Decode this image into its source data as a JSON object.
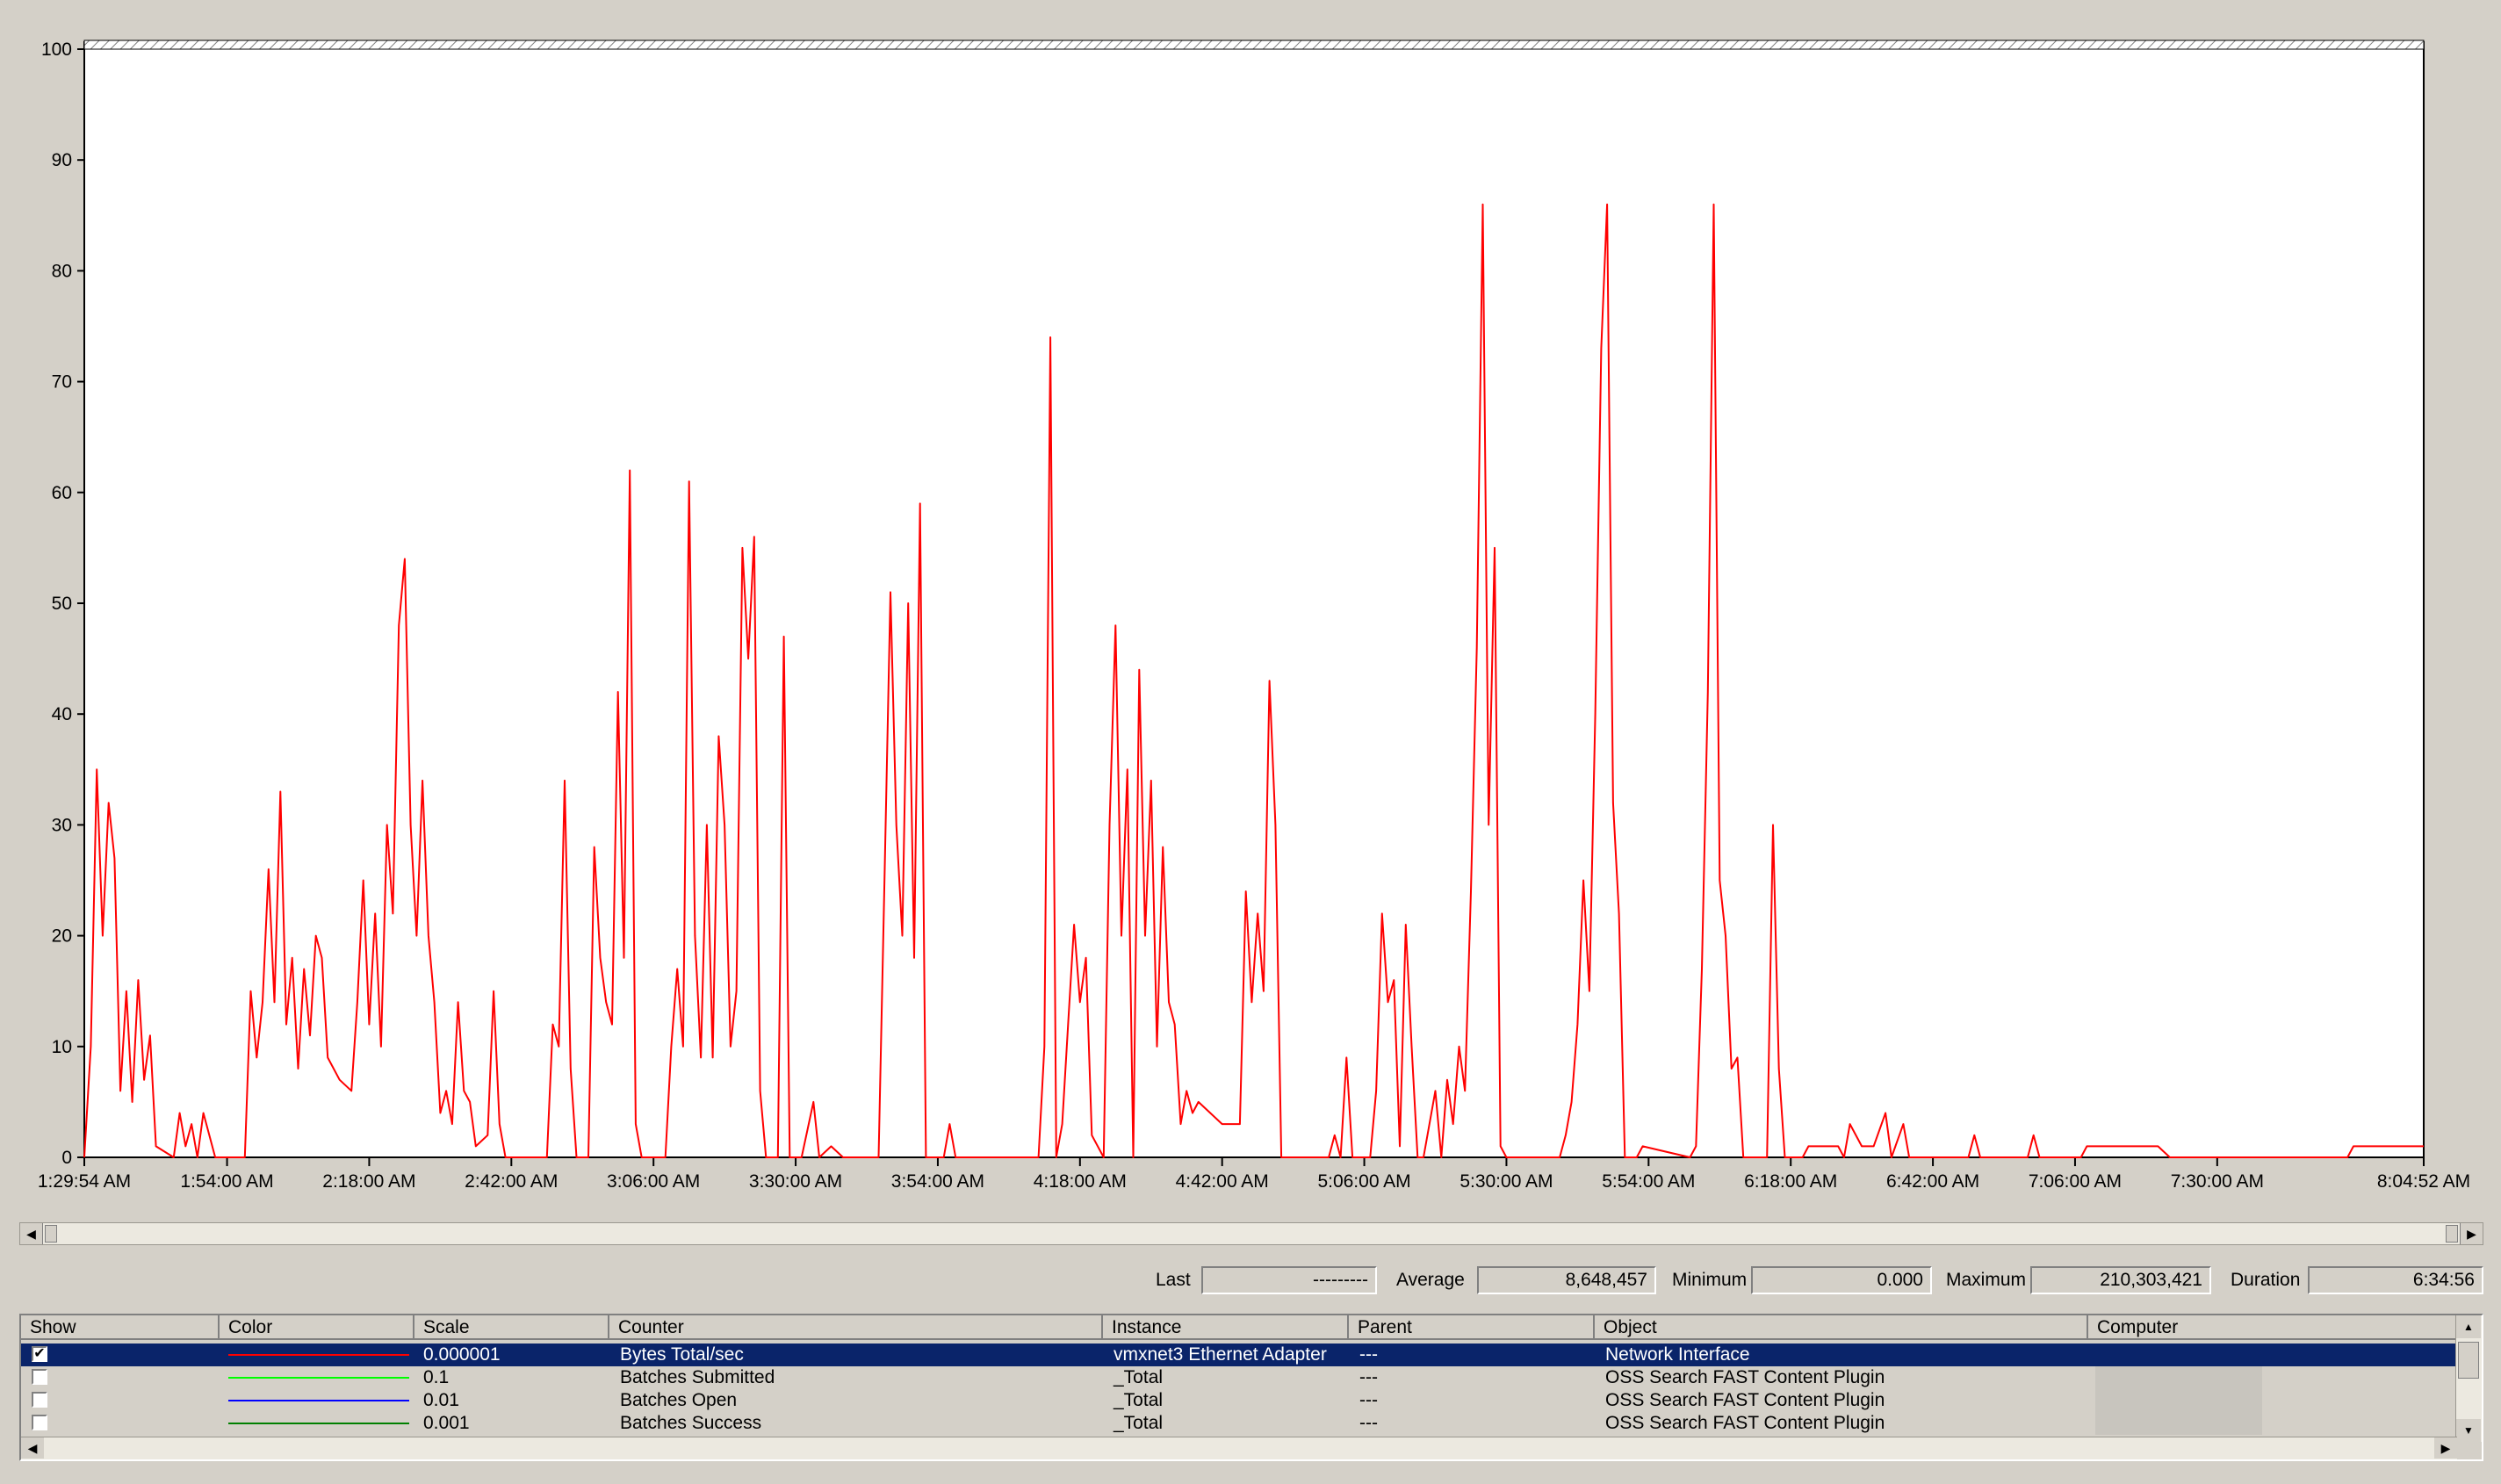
{
  "chart_data": {
    "type": "line",
    "y_ticks": [
      "100",
      "90",
      "80",
      "70",
      "60",
      "50",
      "40",
      "30",
      "20",
      "10",
      "0"
    ],
    "x_ticks": [
      "1:29:54 AM",
      "1:54:00 AM",
      "2:18:00 AM",
      "2:42:00 AM",
      "3:06:00 AM",
      "3:30:00 AM",
      "3:54:00 AM",
      "4:18:00 AM",
      "4:42:00 AM",
      "5:06:00 AM",
      "5:30:00 AM",
      "5:54:00 AM",
      "6:18:00 AM",
      "6:42:00 AM",
      "7:06:00 AM",
      "7:30:00 AM",
      "8:04:52 AM"
    ],
    "xlim": [
      "1:29:54 AM",
      "8:04:52 AM"
    ],
    "ylim": [
      0,
      100
    ],
    "grid": false,
    "series": [
      {
        "color": "#ff0000",
        "points": [
          [
            "1:29:54 AM",
            0
          ],
          [
            "1:31:00 AM",
            10
          ],
          [
            "1:32:00 AM",
            35
          ],
          [
            "1:33:00 AM",
            20
          ],
          [
            "1:34:00 AM",
            32
          ],
          [
            "1:35:00 AM",
            27
          ],
          [
            "1:36:00 AM",
            6
          ],
          [
            "1:37:00 AM",
            15
          ],
          [
            "1:38:00 AM",
            5
          ],
          [
            "1:39:00 AM",
            16
          ],
          [
            "1:40:00 AM",
            7
          ],
          [
            "1:41:00 AM",
            11
          ],
          [
            "1:42:00 AM",
            1
          ],
          [
            "1:45:00 AM",
            0
          ],
          [
            "1:46:00 AM",
            4
          ],
          [
            "1:47:00 AM",
            1
          ],
          [
            "1:48:00 AM",
            3
          ],
          [
            "1:49:00 AM",
            0
          ],
          [
            "1:50:00 AM",
            4
          ],
          [
            "1:52:00 AM",
            0
          ],
          [
            "1:57:00 AM",
            0
          ],
          [
            "1:58:00 AM",
            15
          ],
          [
            "1:59:00 AM",
            9
          ],
          [
            "2:00:00 AM",
            14
          ],
          [
            "2:01:00 AM",
            26
          ],
          [
            "2:02:00 AM",
            14
          ],
          [
            "2:03:00 AM",
            33
          ],
          [
            "2:04:00 AM",
            12
          ],
          [
            "2:05:00 AM",
            18
          ],
          [
            "2:06:00 AM",
            8
          ],
          [
            "2:07:00 AM",
            17
          ],
          [
            "2:08:00 AM",
            11
          ],
          [
            "2:09:00 AM",
            20
          ],
          [
            "2:10:00 AM",
            18
          ],
          [
            "2:11:00 AM",
            9
          ],
          [
            "2:13:00 AM",
            7
          ],
          [
            "2:15:00 AM",
            6
          ],
          [
            "2:16:00 AM",
            14
          ],
          [
            "2:17:00 AM",
            25
          ],
          [
            "2:18:00 AM",
            12
          ],
          [
            "2:19:00 AM",
            22
          ],
          [
            "2:20:00 AM",
            10
          ],
          [
            "2:21:00 AM",
            30
          ],
          [
            "2:22:00 AM",
            22
          ],
          [
            "2:23:00 AM",
            48
          ],
          [
            "2:24:00 AM",
            54
          ],
          [
            "2:25:00 AM",
            30
          ],
          [
            "2:26:00 AM",
            20
          ],
          [
            "2:27:00 AM",
            34
          ],
          [
            "2:28:00 AM",
            20
          ],
          [
            "2:29:00 AM",
            14
          ],
          [
            "2:30:00 AM",
            4
          ],
          [
            "2:31:00 AM",
            6
          ],
          [
            "2:32:00 AM",
            3
          ],
          [
            "2:33:00 AM",
            14
          ],
          [
            "2:34:00 AM",
            6
          ],
          [
            "2:35:00 AM",
            5
          ],
          [
            "2:36:00 AM",
            1
          ],
          [
            "2:38:00 AM",
            2
          ],
          [
            "2:39:00 AM",
            15
          ],
          [
            "2:40:00 AM",
            3
          ],
          [
            "2:41:00 AM",
            0
          ],
          [
            "2:48:00 AM",
            0
          ],
          [
            "2:49:00 AM",
            12
          ],
          [
            "2:50:00 AM",
            10
          ],
          [
            "2:51:00 AM",
            34
          ],
          [
            "2:52:00 AM",
            8
          ],
          [
            "2:53:00 AM",
            0
          ],
          [
            "2:55:00 AM",
            0
          ],
          [
            "2:56:00 AM",
            28
          ],
          [
            "2:57:00 AM",
            18
          ],
          [
            "2:58:00 AM",
            14
          ],
          [
            "2:59:00 AM",
            12
          ],
          [
            "3:00:00 AM",
            42
          ],
          [
            "3:01:00 AM",
            18
          ],
          [
            "3:02:00 AM",
            62
          ],
          [
            "3:03:00 AM",
            3
          ],
          [
            "3:04:00 AM",
            0
          ],
          [
            "3:08:00 AM",
            0
          ],
          [
            "3:09:00 AM",
            10
          ],
          [
            "3:10:00 AM",
            17
          ],
          [
            "3:11:00 AM",
            10
          ],
          [
            "3:12:00 AM",
            61
          ],
          [
            "3:13:00 AM",
            20
          ],
          [
            "3:14:00 AM",
            9
          ],
          [
            "3:15:00 AM",
            30
          ],
          [
            "3:16:00 AM",
            9
          ],
          [
            "3:17:00 AM",
            38
          ],
          [
            "3:18:00 AM",
            30
          ],
          [
            "3:19:00 AM",
            10
          ],
          [
            "3:20:00 AM",
            15
          ],
          [
            "3:21:00 AM",
            55
          ],
          [
            "3:22:00 AM",
            45
          ],
          [
            "3:23:00 AM",
            56
          ],
          [
            "3:24:00 AM",
            6
          ],
          [
            "3:25:00 AM",
            0
          ],
          [
            "3:27:00 AM",
            0
          ],
          [
            "3:28:00 AM",
            47
          ],
          [
            "3:29:00 AM",
            0
          ],
          [
            "3:31:00 AM",
            0
          ],
          [
            "3:33:00 AM",
            5
          ],
          [
            "3:34:00 AM",
            0
          ],
          [
            "3:36:00 AM",
            1
          ],
          [
            "3:38:00 AM",
            0
          ],
          [
            "3:44:00 AM",
            0
          ],
          [
            "3:45:00 AM",
            25
          ],
          [
            "3:46:00 AM",
            51
          ],
          [
            "3:47:00 AM",
            30
          ],
          [
            "3:48:00 AM",
            20
          ],
          [
            "3:49:00 AM",
            50
          ],
          [
            "3:50:00 AM",
            18
          ],
          [
            "3:51:00 AM",
            59
          ],
          [
            "3:52:00 AM",
            0
          ],
          [
            "3:55:00 AM",
            0
          ],
          [
            "3:56:00 AM",
            3
          ],
          [
            "3:57:00 AM",
            0
          ],
          [
            "4:11:00 AM",
            0
          ],
          [
            "4:12:00 AM",
            10
          ],
          [
            "4:13:00 AM",
            74
          ],
          [
            "4:14:00 AM",
            0
          ],
          [
            "4:15:00 AM",
            3
          ],
          [
            "4:16:00 AM",
            12
          ],
          [
            "4:17:00 AM",
            21
          ],
          [
            "4:18:00 AM",
            14
          ],
          [
            "4:19:00 AM",
            18
          ],
          [
            "4:20:00 AM",
            2
          ],
          [
            "4:22:00 AM",
            0
          ],
          [
            "4:23:00 AM",
            30
          ],
          [
            "4:24:00 AM",
            48
          ],
          [
            "4:25:00 AM",
            20
          ],
          [
            "4:26:00 AM",
            35
          ],
          [
            "4:27:00 AM",
            0
          ],
          [
            "4:28:00 AM",
            44
          ],
          [
            "4:29:00 AM",
            20
          ],
          [
            "4:30:00 AM",
            34
          ],
          [
            "4:31:00 AM",
            10
          ],
          [
            "4:32:00 AM",
            28
          ],
          [
            "4:33:00 AM",
            14
          ],
          [
            "4:34:00 AM",
            12
          ],
          [
            "4:35:00 AM",
            3
          ],
          [
            "4:36:00 AM",
            6
          ],
          [
            "4:37:00 AM",
            4
          ],
          [
            "4:38:00 AM",
            5
          ],
          [
            "4:40:00 AM",
            4
          ],
          [
            "4:42:00 AM",
            3
          ],
          [
            "4:45:00 AM",
            3
          ],
          [
            "4:46:00 AM",
            24
          ],
          [
            "4:47:00 AM",
            14
          ],
          [
            "4:48:00 AM",
            22
          ],
          [
            "4:49:00 AM",
            15
          ],
          [
            "4:50:00 AM",
            43
          ],
          [
            "4:51:00 AM",
            30
          ],
          [
            "4:52:00 AM",
            0
          ],
          [
            "5:00:00 AM",
            0
          ],
          [
            "5:01:00 AM",
            2
          ],
          [
            "5:02:00 AM",
            0
          ],
          [
            "5:03:00 AM",
            9
          ],
          [
            "5:04:00 AM",
            0
          ],
          [
            "5:07:00 AM",
            0
          ],
          [
            "5:08:00 AM",
            6
          ],
          [
            "5:09:00 AM",
            22
          ],
          [
            "5:10:00 AM",
            14
          ],
          [
            "5:11:00 AM",
            16
          ],
          [
            "5:12:00 AM",
            1
          ],
          [
            "5:13:00 AM",
            21
          ],
          [
            "5:14:00 AM",
            10
          ],
          [
            "5:15:00 AM",
            0
          ],
          [
            "5:16:00 AM",
            0
          ],
          [
            "5:18:00 AM",
            6
          ],
          [
            "5:19:00 AM",
            0
          ],
          [
            "5:20:00 AM",
            7
          ],
          [
            "5:21:00 AM",
            3
          ],
          [
            "5:22:00 AM",
            10
          ],
          [
            "5:23:00 AM",
            6
          ],
          [
            "5:24:00 AM",
            24
          ],
          [
            "5:25:00 AM",
            46
          ],
          [
            "5:26:00 AM",
            86
          ],
          [
            "5:27:00 AM",
            30
          ],
          [
            "5:28:00 AM",
            55
          ],
          [
            "5:29:00 AM",
            1
          ],
          [
            "5:30:00 AM",
            0
          ],
          [
            "5:39:00 AM",
            0
          ],
          [
            "5:40:00 AM",
            2
          ],
          [
            "5:41:00 AM",
            5
          ],
          [
            "5:42:00 AM",
            12
          ],
          [
            "5:43:00 AM",
            25
          ],
          [
            "5:44:00 AM",
            15
          ],
          [
            "5:45:00 AM",
            40
          ],
          [
            "5:46:00 AM",
            73
          ],
          [
            "5:47:00 AM",
            86
          ],
          [
            "5:48:00 AM",
            32
          ],
          [
            "5:49:00 AM",
            22
          ],
          [
            "5:50:00 AM",
            0
          ],
          [
            "5:52:00 AM",
            0
          ],
          [
            "5:53:00 AM",
            1
          ],
          [
            "6:01:00 AM",
            0
          ],
          [
            "6:02:00 AM",
            1
          ],
          [
            "6:03:00 AM",
            17
          ],
          [
            "6:04:00 AM",
            42
          ],
          [
            "6:05:00 AM",
            86
          ],
          [
            "6:06:00 AM",
            25
          ],
          [
            "6:07:00 AM",
            20
          ],
          [
            "6:08:00 AM",
            8
          ],
          [
            "6:09:00 AM",
            9
          ],
          [
            "6:10:00 AM",
            0
          ],
          [
            "6:14:00 AM",
            0
          ],
          [
            "6:15:00 AM",
            30
          ],
          [
            "6:16:00 AM",
            8
          ],
          [
            "6:17:00 AM",
            0
          ],
          [
            "6:20:00 AM",
            0
          ],
          [
            "6:21:00 AM",
            1
          ],
          [
            "6:25:00 AM",
            1
          ],
          [
            "6:26:00 AM",
            1
          ],
          [
            "6:27:00 AM",
            0
          ],
          [
            "6:28:00 AM",
            3
          ],
          [
            "6:30:00 AM",
            1
          ],
          [
            "6:32:00 AM",
            1
          ],
          [
            "6:34:00 AM",
            4
          ],
          [
            "6:35:00 AM",
            0
          ],
          [
            "6:37:00 AM",
            3
          ],
          [
            "6:38:00 AM",
            0
          ],
          [
            "6:48:00 AM",
            0
          ],
          [
            "6:49:00 AM",
            2
          ],
          [
            "6:50:00 AM",
            0
          ],
          [
            "6:58:00 AM",
            0
          ],
          [
            "6:59:00 AM",
            2
          ],
          [
            "7:00:00 AM",
            0
          ],
          [
            "7:07:00 AM",
            0
          ],
          [
            "7:08:00 AM",
            1
          ],
          [
            "7:20:00 AM",
            1
          ],
          [
            "7:22:00 AM",
            0
          ],
          [
            "7:52:00 AM",
            0
          ],
          [
            "7:53:00 AM",
            1
          ],
          [
            "8:04:52 AM",
            1
          ]
        ]
      }
    ]
  },
  "stats": {
    "last_label": "Last",
    "last_value": "---------",
    "average_label": "Average",
    "average_value": "8,648,457",
    "minimum_label": "Minimum",
    "minimum_value": "0.000",
    "maximum_label": "Maximum",
    "maximum_value": "210,303,421",
    "duration_label": "Duration",
    "duration_value": "6:34:56"
  },
  "legend": {
    "headers": [
      "Show",
      "Color",
      "Scale",
      "Counter",
      "Instance",
      "Parent",
      "Object",
      "Computer"
    ],
    "rows": [
      {
        "checked": true,
        "color": "#ff0000",
        "scale": "0.000001",
        "counter": "Bytes Total/sec",
        "instance": "vmxnet3 Ethernet Adapter",
        "parent": "---",
        "object": "Network Interface",
        "selected": true
      },
      {
        "checked": false,
        "color": "#00ff00",
        "scale": "0.1",
        "counter": "Batches Submitted",
        "instance": "_Total",
        "parent": "---",
        "object": "OSS Search FAST Content Plugin",
        "selected": false
      },
      {
        "checked": false,
        "color": "#0000ff",
        "scale": "0.01",
        "counter": "Batches Open",
        "instance": "_Total",
        "parent": "---",
        "object": "OSS Search FAST Content Plugin",
        "selected": false
      },
      {
        "checked": false,
        "color": "#008000",
        "scale": "0.001",
        "counter": "Batches Success",
        "instance": "_Total",
        "parent": "---",
        "object": "OSS Search FAST Content Plugin",
        "selected": false
      }
    ]
  }
}
